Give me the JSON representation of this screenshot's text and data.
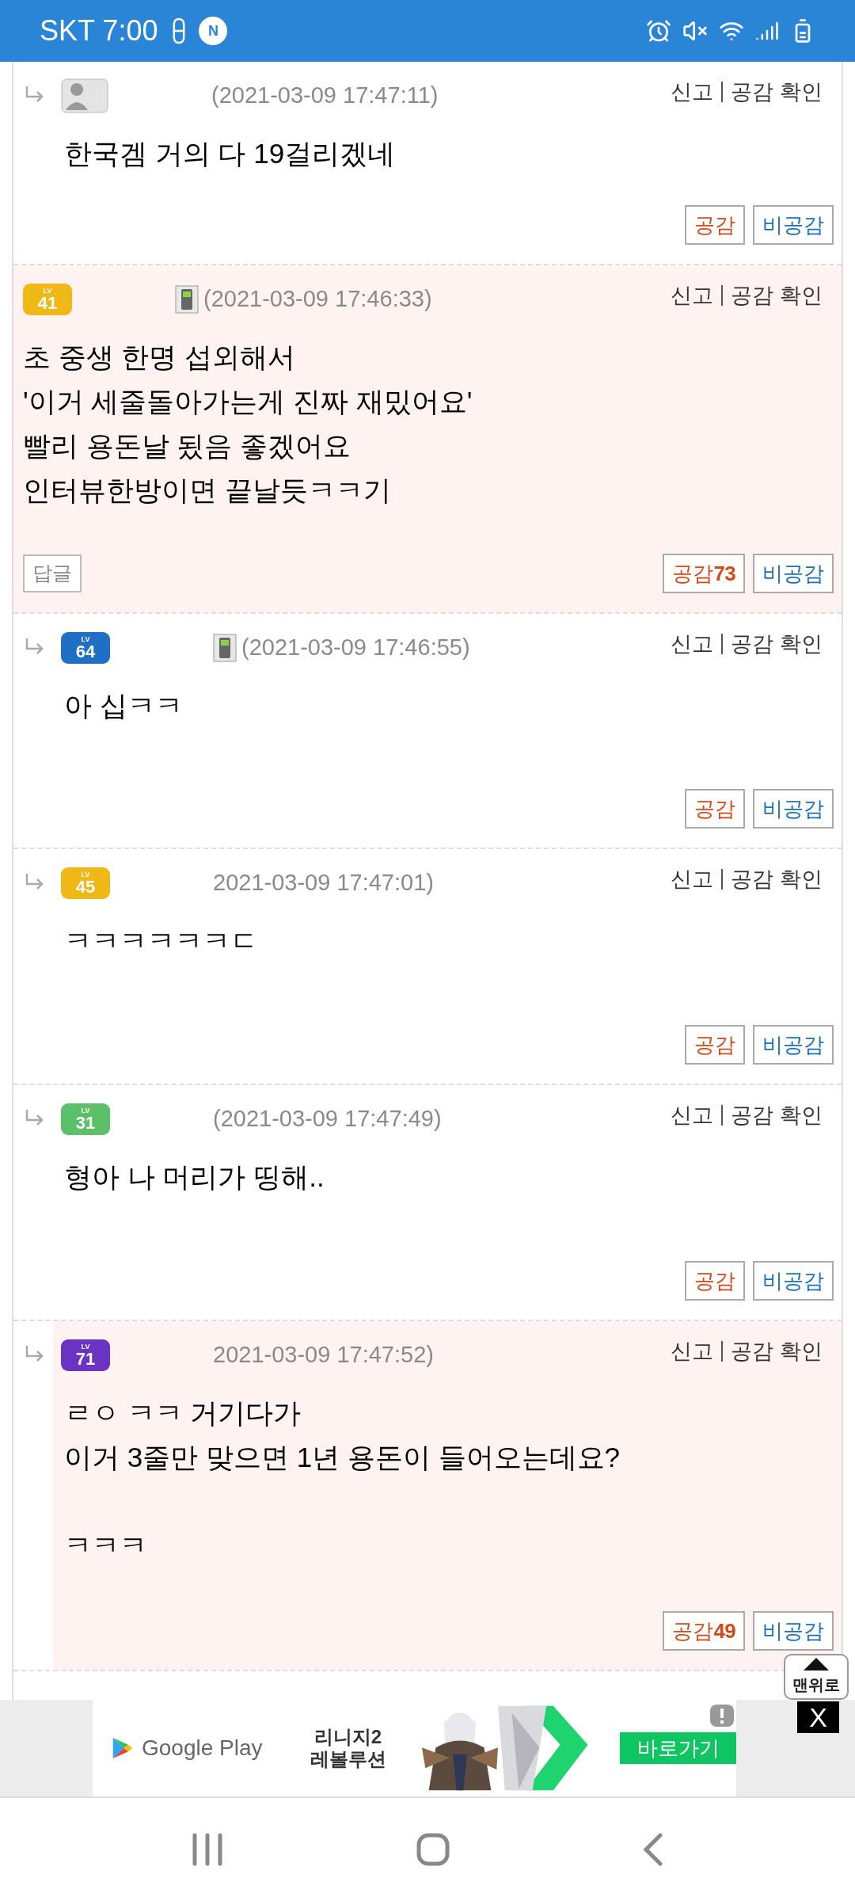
{
  "status_bar": {
    "carrier_time": "SKT 7:00",
    "app_badge": "N"
  },
  "comments": [
    {
      "reply": true,
      "highlighted": false,
      "badge": {
        "kind": "default"
      },
      "mobile": false,
      "time": "(2021-03-09 17:47:11)",
      "report": "신고",
      "check": "공감 확인",
      "paragraphs": [
        [
          "한국겜 거의 다 19걸리겠네"
        ]
      ],
      "like": "공감",
      "dislike": "비공감"
    },
    {
      "reply": false,
      "highlighted": true,
      "badge": {
        "kind": "level",
        "lv": "LV",
        "level": "41",
        "color": "#f0b816"
      },
      "mobile": true,
      "time": "(2021-03-09 17:46:33)",
      "report": "신고",
      "check": "공감 확인",
      "paragraphs": [
        [
          "초 중생 한명 섭외해서",
          "'이거 세줄돌아가는게 진짜 재밌어요'",
          "빨리 용돈날 됬음 좋겠어요",
          "인터뷰한방이면 끝날듯ㅋㅋ기"
        ]
      ],
      "reply_button": "답글",
      "like": "공감",
      "like_count": "73",
      "dislike": "비공감"
    },
    {
      "reply": true,
      "highlighted": false,
      "badge": {
        "kind": "level",
        "lv": "LV",
        "level": "64",
        "color": "#1f6fc4"
      },
      "mobile": true,
      "time": "(2021-03-09 17:46:55)",
      "report": "신고",
      "check": "공감 확인",
      "paragraphs": [
        [
          "아 십ㅋㅋ"
        ]
      ],
      "like": "공감",
      "dislike": "비공감"
    },
    {
      "reply": true,
      "highlighted": false,
      "badge": {
        "kind": "level",
        "lv": "LV",
        "level": "45",
        "color": "#f0b816"
      },
      "mobile": false,
      "time": "2021-03-09 17:47:01)",
      "report": "신고",
      "check": "공감 확인",
      "paragraphs": [
        [
          "ㅋㅋㅋㅋㅋㅋㄷ"
        ]
      ],
      "like": "공감",
      "dislike": "비공감"
    },
    {
      "reply": true,
      "highlighted": false,
      "badge": {
        "kind": "level",
        "lv": "LV",
        "level": "31",
        "color": "#5cbf6a"
      },
      "mobile": false,
      "time": "(2021-03-09 17:47:49)",
      "report": "신고",
      "check": "공감 확인",
      "paragraphs": [
        [
          "형아 나 머리가 띵해.."
        ]
      ],
      "like": "공감",
      "dislike": "비공감"
    },
    {
      "reply": true,
      "highlighted": true,
      "badge": {
        "kind": "level",
        "lv": "LV",
        "level": "71",
        "color": "#6a33c4"
      },
      "mobile": false,
      "time": "2021-03-09 17:47:52)",
      "report": "신고",
      "check": "공감 확인",
      "paragraphs": [
        [
          "ㄹㅇ ㅋㅋ 거기다가",
          "이거 3줄만 맞으면 1년 용돈이 들어오는데요?"
        ],
        [
          "ㅋㅋㅋ"
        ]
      ],
      "like": "공감",
      "like_count": "49",
      "dislike": "비공감"
    }
  ],
  "scroll_top_button": "맨위로",
  "ad": {
    "store": "Google Play",
    "title_lines": [
      "리니지2",
      "레볼루션"
    ],
    "cta": "바로가기",
    "close": "X"
  }
}
